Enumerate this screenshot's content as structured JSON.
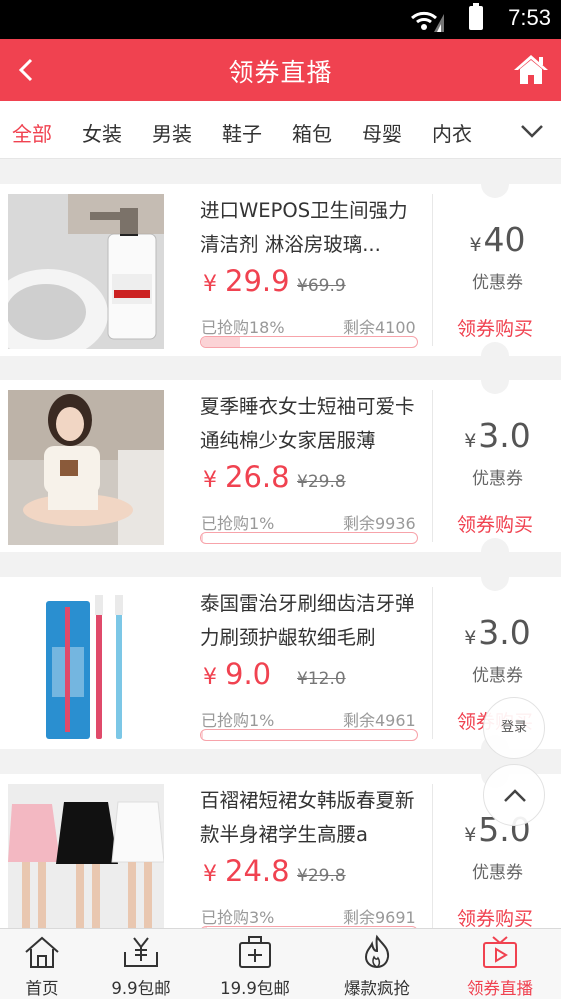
{
  "status_bar": {
    "time": "7:53"
  },
  "header": {
    "title": "领券直播",
    "back_icon": "chevron-left-icon",
    "home_icon": "home-icon"
  },
  "categories": {
    "items": [
      "全部",
      "女装",
      "男装",
      "鞋子",
      "箱包",
      "母婴",
      "内衣"
    ],
    "active_index": 0,
    "more_icon": "chevron-down-icon"
  },
  "products": [
    {
      "name": "进口WEPOS卫生间强力清洁剂 淋浴房玻璃...",
      "yen": "¥",
      "price": "29.9",
      "original_price": "¥69.9",
      "grabbed": "已抢购18%",
      "grabbed_fraction": 0.18,
      "remaining": "剩余4100",
      "coupon_yen": "¥",
      "coupon_value": "40",
      "coupon_label": "优惠券",
      "action": "领券购买"
    },
    {
      "name": "夏季睡衣女士短袖可爱卡通纯棉少女家居服薄",
      "yen": "¥",
      "price": "26.8",
      "original_price": "¥29.8",
      "grabbed": "已抢购1%",
      "grabbed_fraction": 0.01,
      "remaining": "剩余9936",
      "coupon_yen": "¥",
      "coupon_value": "3.0",
      "coupon_label": "优惠券",
      "action": "领券购买"
    },
    {
      "name": "泰国雷治牙刷细齿洁牙弹力刷颈护龈软细毛刷",
      "yen": "¥",
      "price": "9.0",
      "original_price": "¥12.0",
      "grabbed": "已抢购1%",
      "grabbed_fraction": 0.01,
      "remaining": "剩余4961",
      "coupon_yen": "¥",
      "coupon_value": "3.0",
      "coupon_label": "优惠券",
      "action": "领券购买"
    },
    {
      "name": "百褶裙短裙女韩版春夏新款半身裙学生高腰a",
      "yen": "¥",
      "price": "24.8",
      "original_price": "¥29.8",
      "grabbed": "已抢购3%",
      "grabbed_fraction": 0.03,
      "remaining": "剩余9691",
      "coupon_yen": "¥",
      "coupon_value": "5.0",
      "coupon_label": "优惠券",
      "action": "领券购买"
    }
  ],
  "float_buttons": {
    "login": "登录",
    "top_icon": "chevron-up-icon"
  },
  "bottom_nav": {
    "items": [
      {
        "label": "首页",
        "icon": "home-outline-icon"
      },
      {
        "label": "9.9包邮",
        "icon": "yen-tray-icon"
      },
      {
        "label": "19.9包邮",
        "icon": "medical-box-icon"
      },
      {
        "label": "爆款疯抢",
        "icon": "flame-icon"
      },
      {
        "label": "领券直播",
        "icon": "tv-play-icon"
      }
    ],
    "active_index": 4
  },
  "colors": {
    "accent": "#f04250",
    "background": "#f2f2f2"
  }
}
